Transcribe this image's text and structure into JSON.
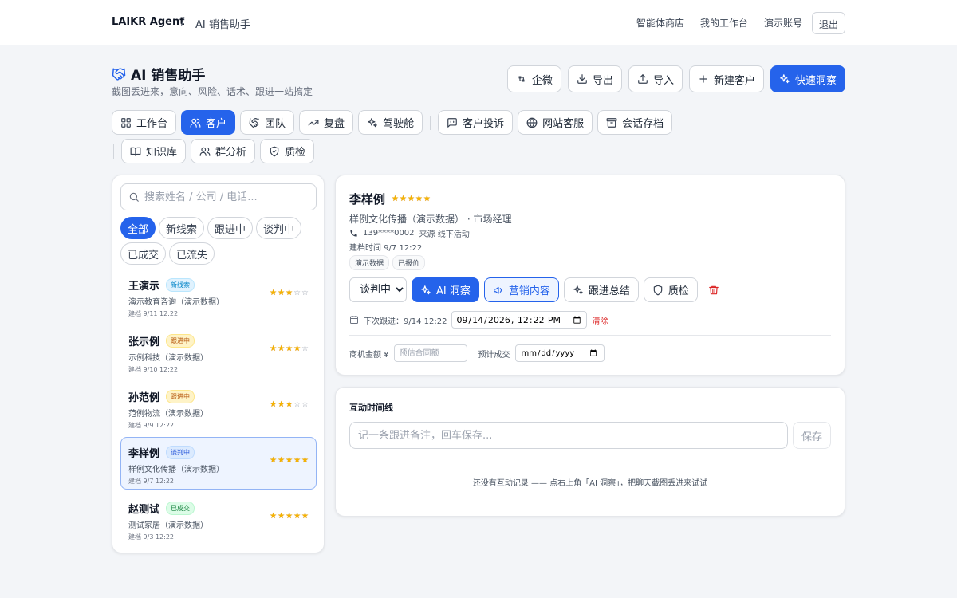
{
  "header": {
    "brand": "LAIKR Agent",
    "separator": "/",
    "page": "AI 销售助手",
    "nav": [
      "智能体商店",
      "我的工作台",
      "演示账号"
    ],
    "logout": "退出"
  },
  "page": {
    "title": "AI 销售助手",
    "subtitle": "截图丢进来，意向、风险、话术、跟进一站搞定",
    "actions": {
      "wecom": "企微",
      "export": "导出",
      "import": "导入",
      "new_customer": "新建客户",
      "quick_insight": "快速洞察"
    }
  },
  "tabs": {
    "workbench": "工作台",
    "customers": "客户",
    "team": "团队",
    "review": "复盘",
    "cockpit": "驾驶舱",
    "complaints": "客户投诉",
    "web_service": "网站客服",
    "archive": "会话存档",
    "knowledge": "知识库",
    "group_analysis": "群分析",
    "quality": "质检"
  },
  "list": {
    "search_placeholder": "搜索姓名 / 公司 / 电话...",
    "filters": [
      "全部",
      "新线索",
      "跟进中",
      "谈判中",
      "已成交",
      "已流失"
    ],
    "customers": [
      {
        "name": "王演示",
        "status": "新线索",
        "company": "演示教育咨询（演示数据）",
        "date": "建档 9/11 12:22",
        "stars": 3
      },
      {
        "name": "张示例",
        "status": "跟进中",
        "company": "示例科技（演示数据）",
        "date": "建档 9/10 12:22",
        "stars": 4
      },
      {
        "name": "孙范例",
        "status": "跟进中",
        "company": "范例物流（演示数据）",
        "date": "建档 9/9 12:22",
        "stars": 3
      },
      {
        "name": "李样例",
        "status": "谈判中",
        "company": "样例文化传播（演示数据）",
        "date": "建档 9/7 12:22",
        "stars": 5
      },
      {
        "name": "赵测试",
        "status": "已成交",
        "company": "测试家居（演示数据）",
        "date": "建档 9/3 12:22",
        "stars": 5
      }
    ]
  },
  "detail": {
    "name": "李样例",
    "stars": 5,
    "company": "样例文化传播（演示数据） · 市场经理",
    "phone": "139****0002",
    "source": "来源 线下活动",
    "created": "建档时间 9/7 12:22",
    "tags": [
      "演示数据",
      "已报价"
    ],
    "status_options": [
      "谈判中"
    ],
    "ai_insight": "AI 洞察",
    "marketing": "营销内容",
    "followup_summary": "跟进总结",
    "quality_check": "质检",
    "next_followup_label": "下次跟进：9/14 12:22",
    "next_followup_value": "2026-09-14T12:22",
    "clear": "清除",
    "deal_amount_label": "商机金额 ¥",
    "deal_amount_placeholder": "预估合同额",
    "expected_close_label": "预计成交"
  },
  "timeline": {
    "title": "互动时间线",
    "input_placeholder": "记一条跟进备注，回车保存...",
    "save": "保存",
    "empty": "还没有互动记录 —— 点右上角「AI 洞察」，把聊天截图丢进来试试"
  },
  "colors": {
    "primary": "#2563eb",
    "star": "#f5b400",
    "danger": "#dc2626",
    "badge_new": "#0ea5e9",
    "badge_follow": "#d97706",
    "badge_negotiate": "#2563eb",
    "badge_won": "#16a34a"
  }
}
